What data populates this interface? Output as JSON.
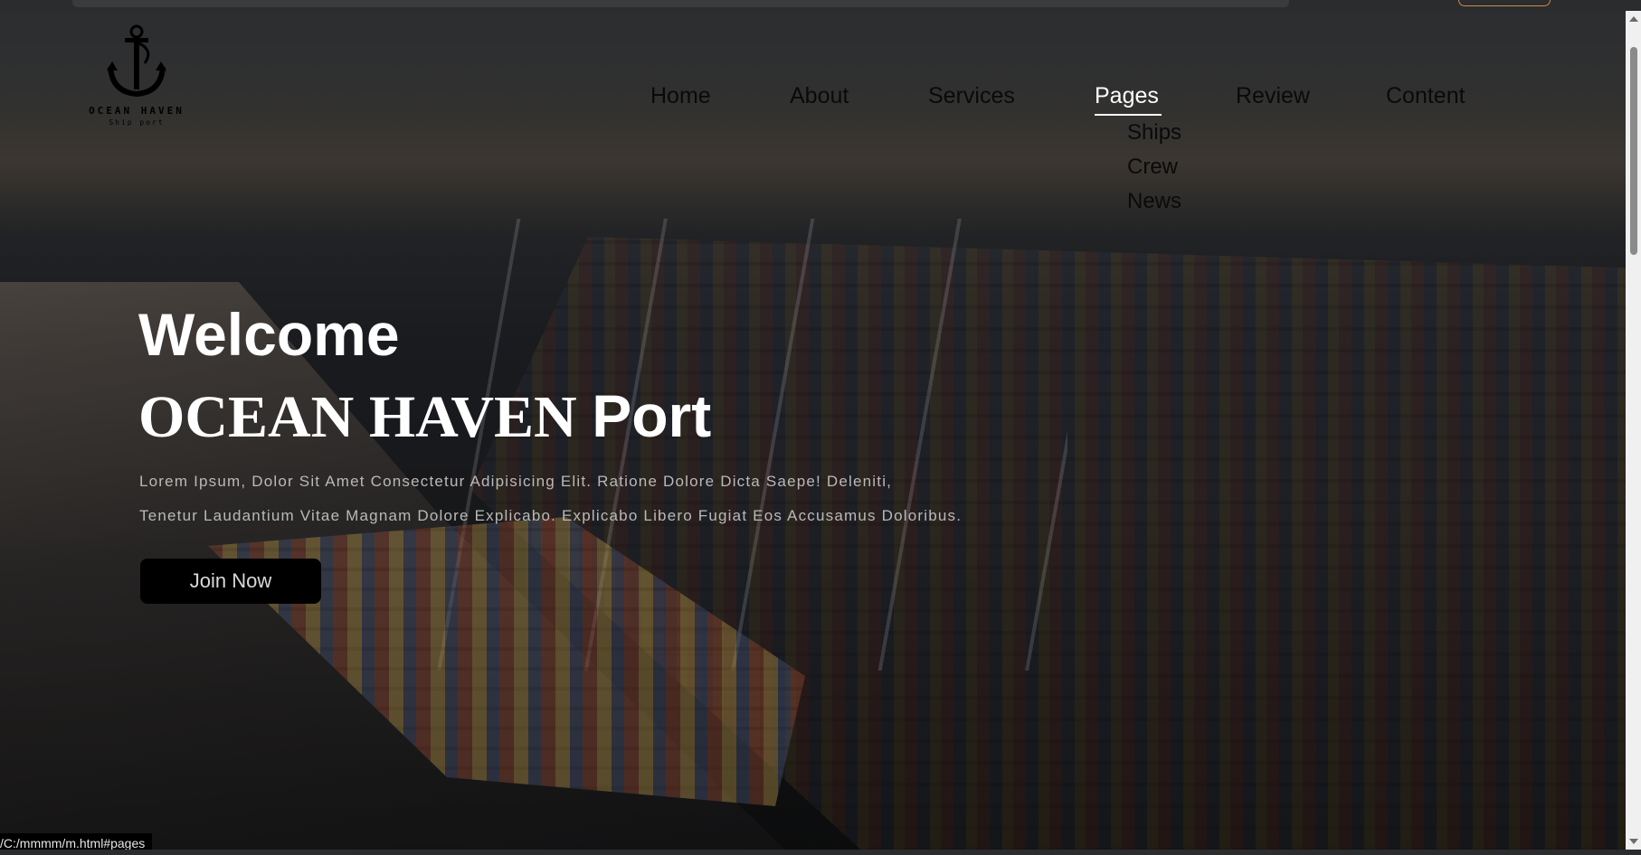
{
  "logo": {
    "brand": "OCEAN HAVEN",
    "tagline": "Ship port",
    "icon": "anchor-icon"
  },
  "nav": {
    "items": [
      {
        "label": "Home"
      },
      {
        "label": "About"
      },
      {
        "label": "Services"
      },
      {
        "label": "Pages"
      },
      {
        "label": "Review"
      },
      {
        "label": "Content"
      }
    ],
    "active": "Pages",
    "dropdown": [
      {
        "label": "Ships"
      },
      {
        "label": "Crew"
      },
      {
        "label": "News"
      }
    ]
  },
  "hero": {
    "title_line1": "Welcome",
    "title_line2_name": "OCEAN HAVEN",
    "title_line2_suffix": "Port",
    "text_line1": "Lorem Ipsum, Dolor Sit Amet Consectetur Adipisicing Elit. Ratione Dolore Dicta Saepe! Deleniti,",
    "text_line2": "Tenetur Laudantium Vitae Magnam Dolore Explicabo. Explicabo Libero Fugiat Eos Accusamus Doloribus.",
    "cta_label": "Join Now"
  },
  "status_bar": {
    "url": "/C:/mmmm/m.html#pages"
  },
  "colors": {
    "nav_text": "#0a0a0a",
    "nav_active": "#ffffff",
    "button_bg": "#000000",
    "hero_text": "#b9b9b9"
  }
}
